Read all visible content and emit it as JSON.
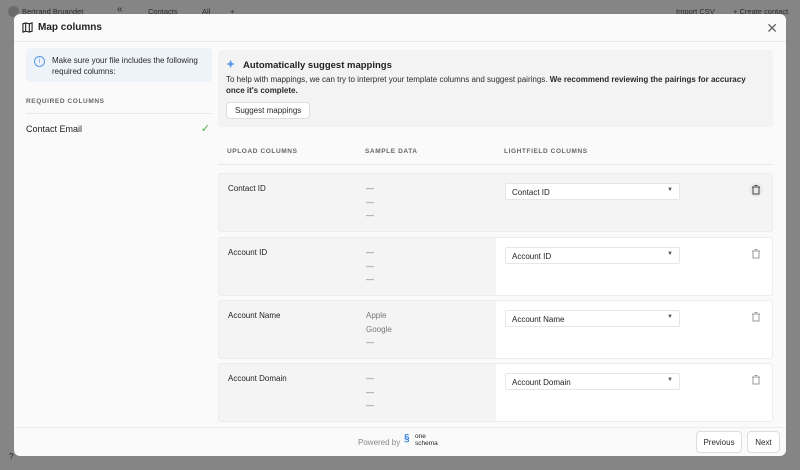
{
  "background": {
    "user": "Bertrand Bruandet",
    "collapse": "«",
    "tab_contacts": "Contacts",
    "view_all": "All",
    "add": "+",
    "import_csv": "Import CSV",
    "create_contact": "+ Create contact",
    "help": "?"
  },
  "modal": {
    "title": "Map columns",
    "close": "✕"
  },
  "left": {
    "info": "Make sure your file includes the following required columns:",
    "required_label": "REQUIRED COLUMNS",
    "required": [
      {
        "name": "Contact Email",
        "status": "✓"
      }
    ]
  },
  "suggest": {
    "title": "Automatically suggest mappings",
    "desc_plain": "To help with mappings, we can try to interpret your template columns and suggest pairings. ",
    "desc_bold": "We recommend reviewing the pairings for accuracy once it's complete.",
    "button": "Suggest mappings"
  },
  "columns": {
    "upload": "UPLOAD COLUMNS",
    "sample": "SAMPLE DATA",
    "lightfield": "LIGHTFIELD COLUMNS"
  },
  "rows": [
    {
      "name": "Contact ID",
      "samples": [
        "—",
        "—",
        "—"
      ],
      "mapping": "Contact ID"
    },
    {
      "name": "Account ID",
      "samples": [
        "—",
        "—",
        "—"
      ],
      "mapping": "Account ID"
    },
    {
      "name": "Account Name",
      "samples": [
        "Apple",
        "Google",
        "—"
      ],
      "mapping": "Account Name"
    },
    {
      "name": "Account Domain",
      "samples": [
        "—",
        "—",
        "—"
      ],
      "mapping": "Account Domain"
    }
  ],
  "footer": {
    "powered_by": "Powered by",
    "logo_line1": "one",
    "logo_line2": "schema",
    "previous": "Previous",
    "next": "Next"
  }
}
